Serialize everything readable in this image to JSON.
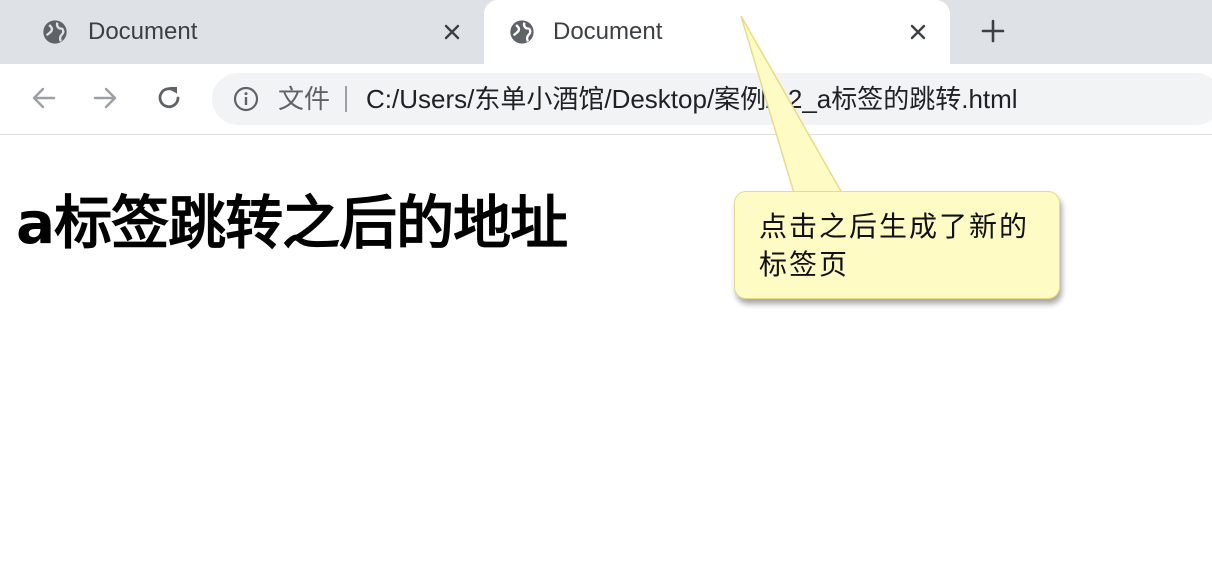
{
  "tabs": [
    {
      "title": "Document",
      "icon": "globe-icon",
      "active": false
    },
    {
      "title": "Document",
      "icon": "globe-icon",
      "active": true
    }
  ],
  "toolbar": {
    "back_icon": "back-arrow-icon",
    "forward_icon": "forward-arrow-icon",
    "reload_icon": "reload-icon"
  },
  "address_bar": {
    "scheme_label": "文件",
    "url": "C:/Users/东单小酒馆/Desktop/案例/12_a标签的跳转.html",
    "icon": "info-icon"
  },
  "page": {
    "heading": "a标签跳转之后的地址"
  },
  "annotation": {
    "text": "点击之后生成了新的标签页",
    "background": "#fffbc4"
  },
  "colors": {
    "tabstrip": "#dee1e6",
    "omnibox": "#f1f3f4",
    "icon": "#5f6368"
  }
}
